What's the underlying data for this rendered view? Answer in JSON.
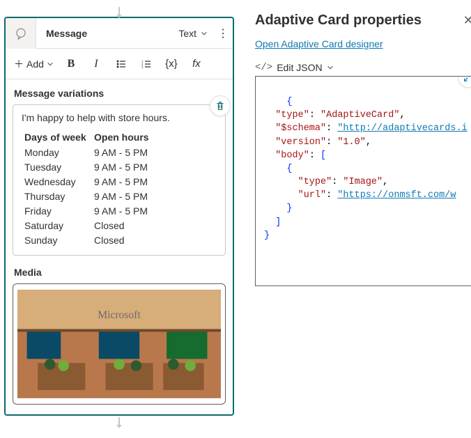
{
  "card": {
    "title": "Message",
    "type_selector": "Text",
    "add_label": "Add",
    "toolbar": {
      "bold": "B",
      "italic": "I",
      "braces": "{x}",
      "fx": "fx"
    }
  },
  "variations": {
    "heading": "Message variations",
    "intro": "I'm happy to help with store hours.",
    "columns": {
      "day": "Days of week",
      "hours": "Open hours"
    },
    "rows": [
      {
        "day": "Monday",
        "hours": "9 AM - 5 PM"
      },
      {
        "day": "Tuesday",
        "hours": "9 AM - 5 PM"
      },
      {
        "day": "Wednesday",
        "hours": "9 AM - 5 PM"
      },
      {
        "day": "Thursday",
        "hours": "9 AM - 5 PM"
      },
      {
        "day": "Friday",
        "hours": "9 AM - 5 PM"
      },
      {
        "day": "Saturday",
        "hours": "Closed"
      },
      {
        "day": "Sunday",
        "hours": "Closed"
      }
    ]
  },
  "media": {
    "heading": "Media",
    "image_label": "Microsoft"
  },
  "panel": {
    "title": "Adaptive Card properties",
    "link": "Open Adaptive Card designer",
    "edit_json": "Edit JSON"
  },
  "json": {
    "k_type": "\"type\"",
    "v_type": "\"AdaptiveCard\"",
    "k_schema": "\"$schema\"",
    "v_schema": "\"http://adaptivecards.i",
    "k_version": "\"version\"",
    "v_version": "\"1.0\"",
    "k_body": "\"body\"",
    "b_k_type": "\"type\"",
    "b_v_type": "\"Image\"",
    "b_k_url": "\"url\"",
    "b_v_url": "\"https://onmsft.com/w"
  }
}
